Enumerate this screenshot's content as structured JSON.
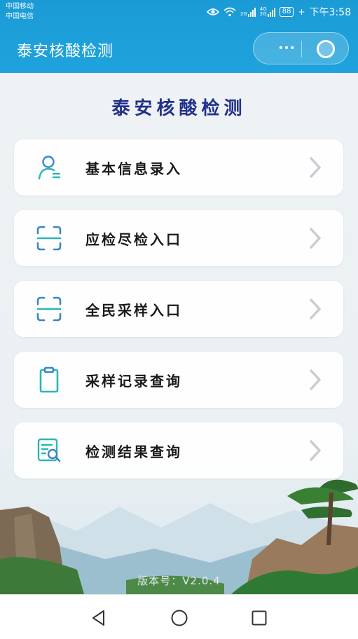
{
  "status_bar": {
    "carrier_1": "中国移动",
    "carrier_2": "中国电信",
    "net_1": "2G",
    "net_2": "4G 2G",
    "battery": "88",
    "time": "下午3:58"
  },
  "header": {
    "title": "泰安核酸检测",
    "more_icon": "more-dots-icon",
    "close_icon": "close-circle-icon"
  },
  "main": {
    "title": "泰安核酸检测",
    "menu": [
      {
        "label": "基本信息录入",
        "icon": "user-info-icon"
      },
      {
        "label": "应检尽检入口",
        "icon": "scan-icon"
      },
      {
        "label": "全民采样入口",
        "icon": "scan-icon"
      },
      {
        "label": "采样记录查询",
        "icon": "clipboard-icon"
      },
      {
        "label": "检测结果查询",
        "icon": "search-document-icon"
      }
    ],
    "version": "版本号：V2.0.4"
  },
  "nav": {
    "back": "back-icon",
    "home": "home-icon",
    "recent": "recent-apps-icon"
  },
  "colors": {
    "header_blue": "#1b9bd6",
    "title_navy": "#22318a",
    "icon_blue": "#3a86c8",
    "icon_teal": "#2ab7b5"
  }
}
